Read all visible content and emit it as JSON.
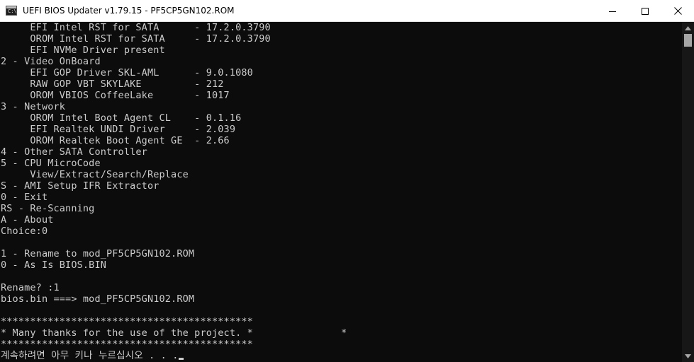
{
  "window": {
    "title": "UEFI BIOS Updater v1.79.15 - PF5CP5GN102.ROM",
    "icon_text": "C:\\",
    "controls": {
      "minimize": "minimize-icon",
      "maximize": "maximize-icon",
      "close": "close-icon"
    }
  },
  "console": {
    "lines": [
      "     EFI Intel RST for SATA      - 17.2.0.3790",
      "     OROM Intel RST for SATA     - 17.2.0.3790",
      "     EFI NVMe Driver present",
      "2 - Video OnBoard",
      "     EFI GOP Driver SKL-AML      - 9.0.1080",
      "     RAW GOP VBT SKYLAKE         - 212",
      "     OROM VBIOS CoffeeLake       - 1017",
      "3 - Network",
      "     OROM Intel Boot Agent CL    - 0.1.16",
      "     EFI Realtek UNDI Driver     - 2.039",
      "     OROM Realtek Boot Agent GE  - 2.66",
      "4 - Other SATA Controller",
      "5 - CPU MicroCode",
      "     View/Extract/Search/Replace",
      "S - AMI Setup IFR Extractor",
      "0 - Exit",
      "RS - Re-Scanning",
      "A - About",
      "Choice:0",
      "",
      "1 - Rename to mod_PF5CP5GN102.ROM",
      "0 - As Is BIOS.BIN",
      "",
      "Rename? :1",
      "bios.bin ===> mod_PF5CP5GN102.ROM",
      "",
      "*******************************************",
      "* Many thanks for the use of the project. *               *",
      "*******************************************"
    ],
    "prompt": "계속하려면 아무 키나 누르십시오 . . ."
  },
  "colors": {
    "background": "#0c0c0c",
    "text": "#cccccc",
    "titlebar": "#ffffff",
    "scrollbar_track": "#171717",
    "scrollbar_thumb": "#a6a6a6"
  },
  "scroll_position": 0.96
}
